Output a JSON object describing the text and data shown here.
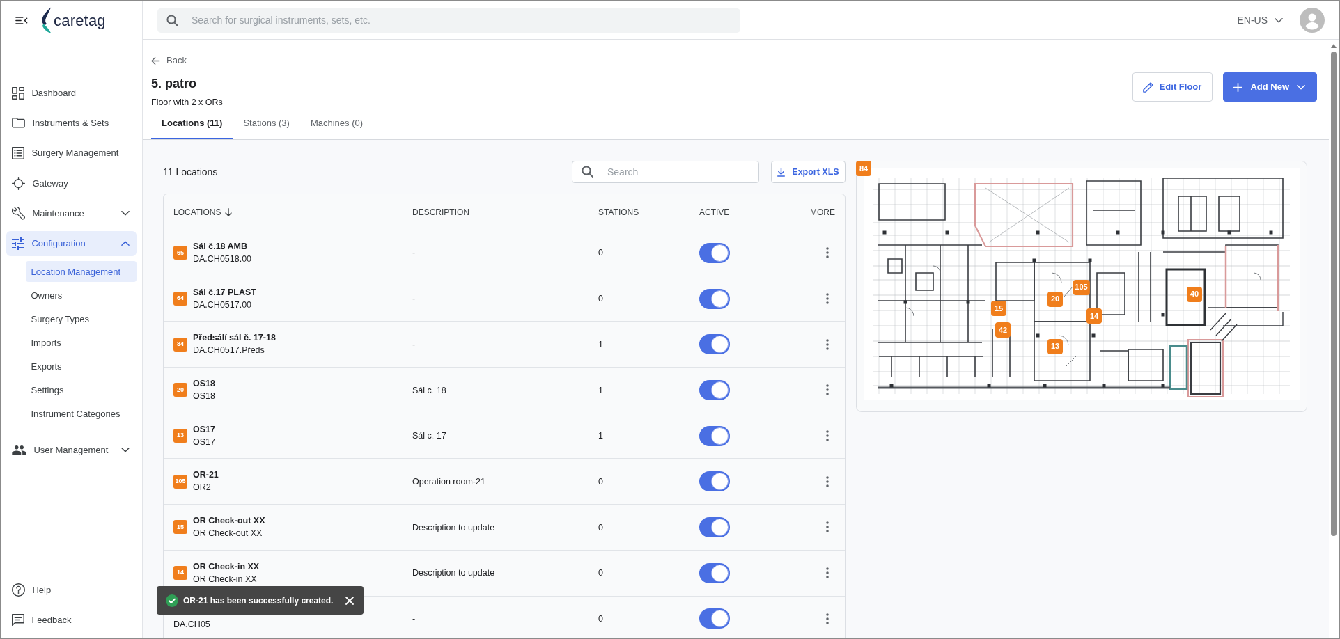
{
  "topbar": {
    "brand": "caretag",
    "search": {
      "placeholder": "Search for surgical instruments, sets, etc."
    },
    "language": "EN-US"
  },
  "sidebar": {
    "items": [
      {
        "label": "Dashboard",
        "selected": false
      },
      {
        "label": "Instruments & Sets",
        "selected": false
      },
      {
        "label": "Surgery Management",
        "selected": false
      },
      {
        "label": "Gateway",
        "selected": false
      },
      {
        "label": "Maintenance",
        "selected": false,
        "expanded": false
      },
      {
        "label": "Configuration",
        "selected": true,
        "expanded": true,
        "children": [
          {
            "label": "Location Management",
            "selected": true
          },
          {
            "label": "Owners",
            "selected": false
          },
          {
            "label": "Surgery Types",
            "selected": false
          },
          {
            "label": "Imports",
            "selected": false
          },
          {
            "label": "Exports",
            "selected": false
          },
          {
            "label": "Settings",
            "selected": false
          },
          {
            "label": "Instrument Categories",
            "selected": false
          }
        ]
      },
      {
        "label": "User Management",
        "selected": false,
        "expanded": false
      }
    ],
    "footer_items": [
      {
        "label": "Help"
      },
      {
        "label": "Feedback"
      }
    ]
  },
  "page": {
    "back": "Back",
    "title": "5. patro",
    "subtitle": "Floor with 2 x ORs",
    "actions": [
      {
        "label": "Edit Floor",
        "kind": "outline"
      },
      {
        "label": "Add New",
        "kind": "primary"
      }
    ],
    "tabs": [
      {
        "label": "Locations (11)",
        "selected": true
      },
      {
        "label": "Stations (3)",
        "selected": false
      },
      {
        "label": "Machines (0)",
        "selected": false
      }
    ]
  },
  "locations": {
    "count_label": "11 Locations",
    "search": {
      "placeholder": "Search"
    },
    "export_label": "Export XLS",
    "columns": [
      {
        "label": "LOCATIONS",
        "sorted": true
      },
      {
        "label": "DESCRIPTION",
        "sorted": false
      },
      {
        "label": "STATIONS",
        "sorted": false
      },
      {
        "label": "ACTIVE",
        "sorted": false
      },
      {
        "label": "MORE",
        "sorted": false
      }
    ],
    "rows": [
      {
        "badge": "65",
        "name": "Sál č.18 AMB",
        "code": "DA.CH0518.00",
        "description": "-",
        "stations": "0",
        "active": true
      },
      {
        "badge": "64",
        "name": "Sál č.17 PLAST",
        "code": "DA.CH0517.00",
        "description": "-",
        "stations": "0",
        "active": true
      },
      {
        "badge": "84",
        "name": "Předsálí sál č. 17-18",
        "code": "DA.CH0517.Předs",
        "description": "-",
        "stations": "1",
        "active": true
      },
      {
        "badge": "20",
        "name": "OS18",
        "code": "OS18",
        "description": "Sál c. 18",
        "stations": "1",
        "active": true
      },
      {
        "badge": "13",
        "name": "OS17",
        "code": "OS17",
        "description": "Sál c. 17",
        "stations": "1",
        "active": true
      },
      {
        "badge": "105",
        "name": "OR-21",
        "code": "OR2",
        "description": "Operation room-21",
        "stations": "0",
        "active": true
      },
      {
        "badge": "15",
        "name": "OR Check-out XX",
        "code": "OR Check-out XX",
        "description": "Description to update",
        "stations": "0",
        "active": true
      },
      {
        "badge": "14",
        "name": "OR Check-in XX",
        "code": "OR Check-in XX",
        "description": "Description to update",
        "stations": "0",
        "active": true
      },
      {
        "code": "DA.CH05",
        "description": "-",
        "stations": "0",
        "active": true
      }
    ]
  },
  "floor_plan": {
    "markers": [
      {
        "label": "84"
      },
      {
        "label": "105"
      },
      {
        "label": "40"
      },
      {
        "label": "20"
      },
      {
        "label": "15"
      },
      {
        "label": "14"
      },
      {
        "label": "42"
      },
      {
        "label": "13"
      }
    ]
  },
  "toast": {
    "message": "OR-21 has been successfully created."
  }
}
